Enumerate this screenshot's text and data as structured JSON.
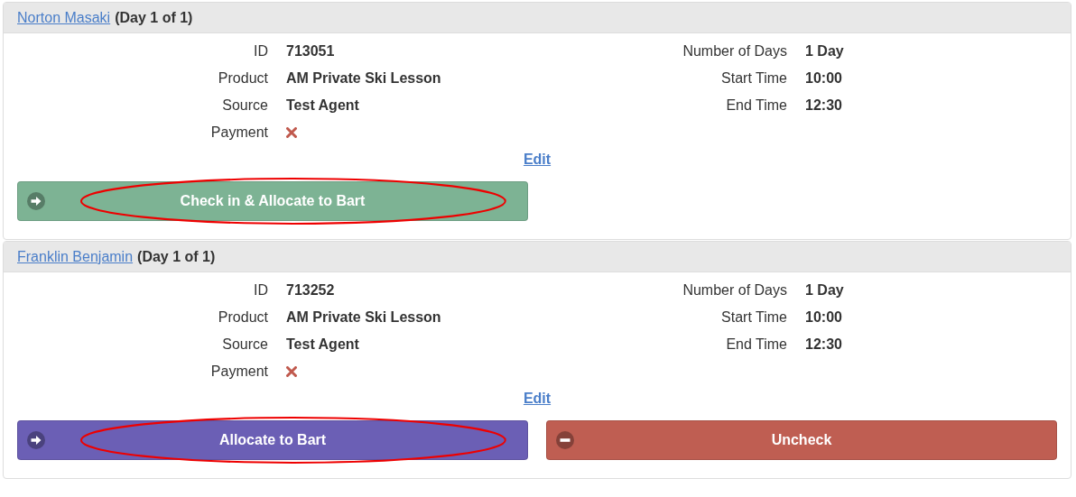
{
  "bookings": [
    {
      "name": "Norton Masaki",
      "day": "(Day 1 of 1)",
      "left": [
        {
          "label": "ID",
          "value": "713051"
        },
        {
          "label": "Product",
          "value": "AM Private Ski Lesson"
        },
        {
          "label": "Source",
          "value": "Test Agent"
        }
      ],
      "paid": false,
      "payment_label": "Payment",
      "right": [
        {
          "label": "Number of Days",
          "value": "1 Day"
        },
        {
          "label": "Start Time",
          "value": "10:00"
        },
        {
          "label": "End Time",
          "value": "12:30"
        }
      ],
      "edit": "Edit",
      "buttons": [
        {
          "kind": "checkin",
          "label": "Check in & Allocate to Bart",
          "highlighted": true
        }
      ]
    },
    {
      "name": "Franklin Benjamin",
      "day": "(Day 1 of 1)",
      "left": [
        {
          "label": "ID",
          "value": "713252"
        },
        {
          "label": "Product",
          "value": "AM Private Ski Lesson"
        },
        {
          "label": "Source",
          "value": "Test Agent"
        }
      ],
      "paid": false,
      "payment_label": "Payment",
      "right": [
        {
          "label": "Number of Days",
          "value": "1 Day"
        },
        {
          "label": "Start Time",
          "value": "10:00"
        },
        {
          "label": "End Time",
          "value": "12:30"
        }
      ],
      "edit": "Edit",
      "buttons": [
        {
          "kind": "allocate",
          "label": "Allocate to Bart",
          "highlighted": true
        },
        {
          "kind": "uncheck",
          "label": "Uncheck",
          "highlighted": false
        }
      ]
    }
  ]
}
